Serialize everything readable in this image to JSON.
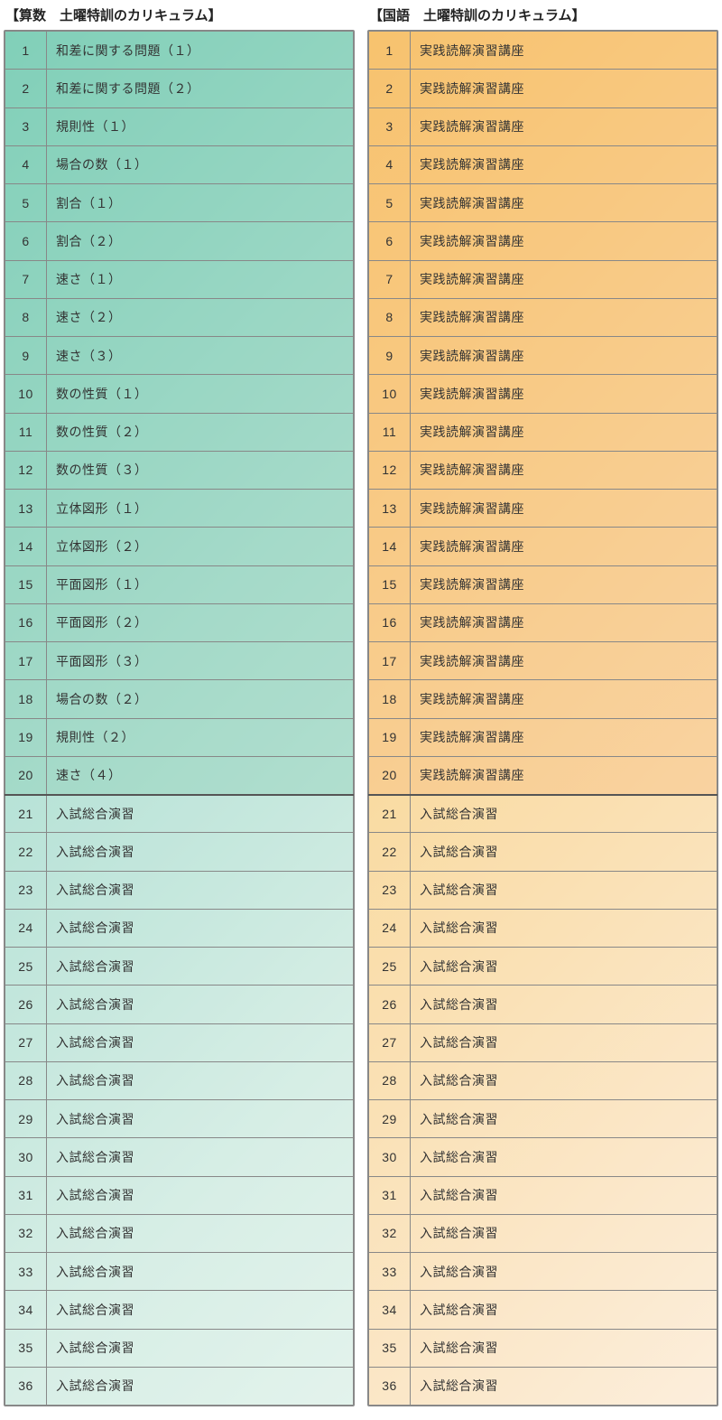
{
  "columns": [
    {
      "key": "math",
      "title": "【算数　土曜特訓のカリキュラム】",
      "rows": [
        {
          "n": 1,
          "t": "和差に関する問題（１）",
          "p": 1
        },
        {
          "n": 2,
          "t": "和差に関する問題（２）",
          "p": 1
        },
        {
          "n": 3,
          "t": "規則性（１）",
          "p": 1
        },
        {
          "n": 4,
          "t": "場合の数（１）",
          "p": 1
        },
        {
          "n": 5,
          "t": "割合（１）",
          "p": 1
        },
        {
          "n": 6,
          "t": "割合（２）",
          "p": 1
        },
        {
          "n": 7,
          "t": "速さ（１）",
          "p": 1
        },
        {
          "n": 8,
          "t": "速さ（２）",
          "p": 1
        },
        {
          "n": 9,
          "t": "速さ（３）",
          "p": 1
        },
        {
          "n": 10,
          "t": "数の性質（１）",
          "p": 1
        },
        {
          "n": 11,
          "t": "数の性質（２）",
          "p": 1
        },
        {
          "n": 12,
          "t": "数の性質（３）",
          "p": 1
        },
        {
          "n": 13,
          "t": "立体図形（１）",
          "p": 1
        },
        {
          "n": 14,
          "t": "立体図形（２）",
          "p": 1
        },
        {
          "n": 15,
          "t": "平面図形（１）",
          "p": 1
        },
        {
          "n": 16,
          "t": "平面図形（２）",
          "p": 1
        },
        {
          "n": 17,
          "t": "平面図形（３）",
          "p": 1
        },
        {
          "n": 18,
          "t": "場合の数（２）",
          "p": 1
        },
        {
          "n": 19,
          "t": "規則性（２）",
          "p": 1
        },
        {
          "n": 20,
          "t": "速さ（４）",
          "p": 1
        },
        {
          "n": 21,
          "t": "入試総合演習",
          "p": 2
        },
        {
          "n": 22,
          "t": "入試総合演習",
          "p": 2
        },
        {
          "n": 23,
          "t": "入試総合演習",
          "p": 2
        },
        {
          "n": 24,
          "t": "入試総合演習",
          "p": 2
        },
        {
          "n": 25,
          "t": "入試総合演習",
          "p": 2
        },
        {
          "n": 26,
          "t": "入試総合演習",
          "p": 2
        },
        {
          "n": 27,
          "t": "入試総合演習",
          "p": 2
        },
        {
          "n": 28,
          "t": "入試総合演習",
          "p": 2
        },
        {
          "n": 29,
          "t": "入試総合演習",
          "p": 2
        },
        {
          "n": 30,
          "t": "入試総合演習",
          "p": 2
        },
        {
          "n": 31,
          "t": "入試総合演習",
          "p": 2
        },
        {
          "n": 32,
          "t": "入試総合演習",
          "p": 2
        },
        {
          "n": 33,
          "t": "入試総合演習",
          "p": 2
        },
        {
          "n": 34,
          "t": "入試総合演習",
          "p": 2
        },
        {
          "n": 35,
          "t": "入試総合演習",
          "p": 2
        },
        {
          "n": 36,
          "t": "入試総合演習",
          "p": 2
        }
      ]
    },
    {
      "key": "jap",
      "title": "【国語　土曜特訓のカリキュラム】",
      "rows": [
        {
          "n": 1,
          "t": "実践読解演習講座",
          "p": 1
        },
        {
          "n": 2,
          "t": "実践読解演習講座",
          "p": 1
        },
        {
          "n": 3,
          "t": "実践読解演習講座",
          "p": 1
        },
        {
          "n": 4,
          "t": "実践読解演習講座",
          "p": 1
        },
        {
          "n": 5,
          "t": "実践読解演習講座",
          "p": 1
        },
        {
          "n": 6,
          "t": "実践読解演習講座",
          "p": 1
        },
        {
          "n": 7,
          "t": "実践読解演習講座",
          "p": 1
        },
        {
          "n": 8,
          "t": "実践読解演習講座",
          "p": 1
        },
        {
          "n": 9,
          "t": "実践読解演習講座",
          "p": 1
        },
        {
          "n": 10,
          "t": "実践読解演習講座",
          "p": 1
        },
        {
          "n": 11,
          "t": "実践読解演習講座",
          "p": 1
        },
        {
          "n": 12,
          "t": "実践読解演習講座",
          "p": 1
        },
        {
          "n": 13,
          "t": "実践読解演習講座",
          "p": 1
        },
        {
          "n": 14,
          "t": "実践読解演習講座",
          "p": 1
        },
        {
          "n": 15,
          "t": "実践読解演習講座",
          "p": 1
        },
        {
          "n": 16,
          "t": "実践読解演習講座",
          "p": 1
        },
        {
          "n": 17,
          "t": "実践読解演習講座",
          "p": 1
        },
        {
          "n": 18,
          "t": "実践読解演習講座",
          "p": 1
        },
        {
          "n": 19,
          "t": "実践読解演習講座",
          "p": 1
        },
        {
          "n": 20,
          "t": "実践読解演習講座",
          "p": 1
        },
        {
          "n": 21,
          "t": "入試総合演習",
          "p": 2
        },
        {
          "n": 22,
          "t": "入試総合演習",
          "p": 2
        },
        {
          "n": 23,
          "t": "入試総合演習",
          "p": 2
        },
        {
          "n": 24,
          "t": "入試総合演習",
          "p": 2
        },
        {
          "n": 25,
          "t": "入試総合演習",
          "p": 2
        },
        {
          "n": 26,
          "t": "入試総合演習",
          "p": 2
        },
        {
          "n": 27,
          "t": "入試総合演習",
          "p": 2
        },
        {
          "n": 28,
          "t": "入試総合演習",
          "p": 2
        },
        {
          "n": 29,
          "t": "入試総合演習",
          "p": 2
        },
        {
          "n": 30,
          "t": "入試総合演習",
          "p": 2
        },
        {
          "n": 31,
          "t": "入試総合演習",
          "p": 2
        },
        {
          "n": 32,
          "t": "入試総合演習",
          "p": 2
        },
        {
          "n": 33,
          "t": "入試総合演習",
          "p": 2
        },
        {
          "n": 34,
          "t": "入試総合演習",
          "p": 2
        },
        {
          "n": 35,
          "t": "入試総合演習",
          "p": 2
        },
        {
          "n": 36,
          "t": "入試総合演習",
          "p": 2
        }
      ]
    }
  ]
}
